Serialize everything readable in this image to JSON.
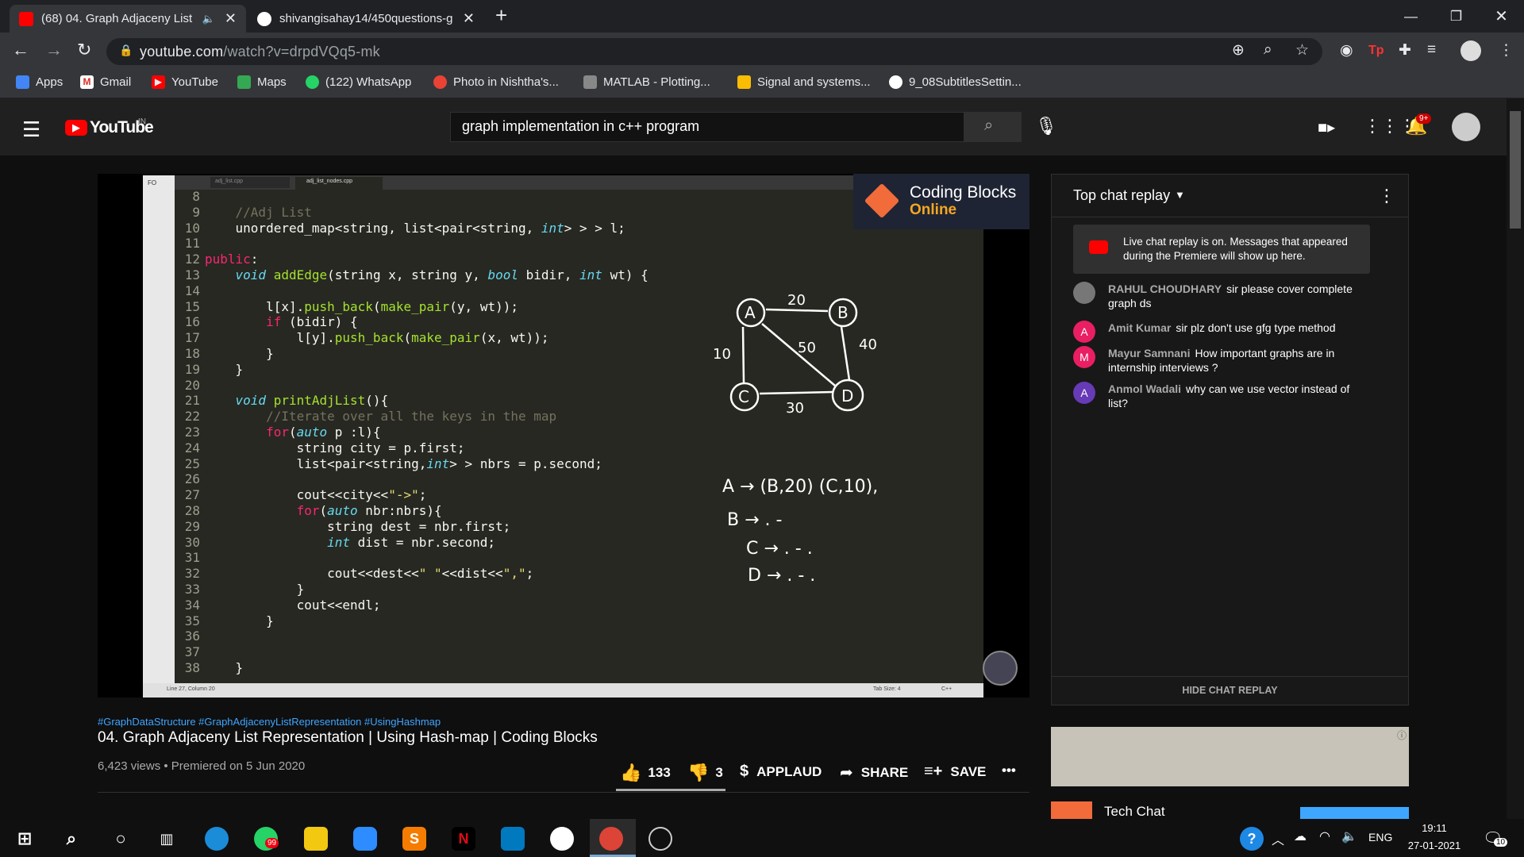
{
  "browser": {
    "tabs": [
      {
        "title": "(68) 04. Graph Adjaceny List",
        "active": true
      },
      {
        "title": "shivangisahay14/450questions-g",
        "active": false
      }
    ],
    "url_host": "youtube.com",
    "url_path": "/watch?v=drpdVQq5-mk",
    "bookmarks": [
      "Apps",
      "Gmail",
      "YouTube",
      "Maps",
      "(122) WhatsApp",
      "Photo in Nishtha's...",
      "MATLAB - Plotting...",
      "Signal and systems...",
      "9_08SubtitlesSettin..."
    ]
  },
  "youtube": {
    "logo_text": "YouTube",
    "logo_region": "IN",
    "search_value": "graph implementation in c++ program",
    "notif_badge": "9+"
  },
  "video": {
    "brand_line1": "Coding Blocks",
    "brand_line2": "Online",
    "tab1": "adj_list.cpp",
    "tab2": "adj_list_nodes.cpp",
    "status_left": "Line 27, Column 20",
    "status_tab": "Tab Size: 4",
    "status_lang": "C++",
    "line_numbers": [
      "8",
      "9",
      "10",
      "11",
      "12",
      "13",
      "14",
      "15",
      "16",
      "17",
      "18",
      "19",
      "20",
      "21",
      "22",
      "23",
      "24",
      "25",
      "26",
      "27",
      "28",
      "29",
      "30",
      "31",
      "32",
      "33",
      "34",
      "35",
      "36",
      "37",
      "38"
    ],
    "code_lines": [
      "    //Adj List",
      "    unordered_map<string, list<pair<string, int> > > l;",
      "",
      "public:",
      "    void addEdge(string x, string y, bool bidir, int wt) {",
      "",
      "        l[x].push_back(make_pair(y, wt));",
      "        if (bidir) {",
      "            l[y].push_back(make_pair(x, wt));",
      "        }",
      "    }",
      "",
      "    void printAdjList(){",
      "        //Iterate over all the keys in the map",
      "        for(auto p :l){",
      "            string city = p.first;",
      "            list<pair<string,int> > nbrs = p.second;",
      "",
      "            cout<<city<<\"->\";",
      "            for(auto nbr:nbrs){",
      "                string dest = nbr.first;",
      "                int dist = nbr.second;",
      "",
      "                cout<<dest<<\" \"<<dist<<\",\";",
      "            }",
      "            cout<<endl;",
      "        }",
      "",
      "",
      "    }"
    ],
    "graph_nodes": [
      "A",
      "B",
      "C",
      "D"
    ],
    "graph_weights": [
      "20",
      "10",
      "50",
      "40",
      "30"
    ],
    "notes": [
      "A → (B,20) (C,10),",
      "B → . -",
      "C → . - .",
      "D → . - ."
    ]
  },
  "below": {
    "hashtags": "#GraphDataStructure #GraphAdjacenyListRepresentation #UsingHashmap",
    "title": "04. Graph Adjaceny List Representation | Using Hash-map | Coding Blocks",
    "meta": "6,423 views • Premiered on 5 Jun 2020",
    "likes": "133",
    "dislikes": "3",
    "applaud": "APPLAUD",
    "share": "SHARE",
    "save": "SAVE"
  },
  "chat": {
    "header": "Top chat replay",
    "banner": "Live chat replay is on. Messages that appeared during the Premiere will show up here.",
    "messages": [
      {
        "avatar": "",
        "author": "RAHUL CHOUDHARY",
        "text": "sir please cover complete graph ds",
        "color": "#777"
      },
      {
        "avatar": "A",
        "author": "Amit Kumar",
        "text": "sir plz don't use gfg type method",
        "color": "#e91e63"
      },
      {
        "avatar": "M",
        "author": "Mayur Samnani",
        "text": "How important graphs are in internship interviews ?",
        "color": "#e91e63"
      },
      {
        "avatar": "A",
        "author": "Anmol Wadali",
        "text": "why can we use vector instead of list?",
        "color": "#673ab7"
      }
    ],
    "hide_button": "HIDE CHAT REPLAY"
  },
  "sidebar": {
    "next_title": "Tech Chat"
  },
  "taskbar": {
    "whatsapp_badge": "99",
    "lang": "ENG",
    "time": "19:11",
    "date": "27-01-2021",
    "notif_count": "10"
  }
}
